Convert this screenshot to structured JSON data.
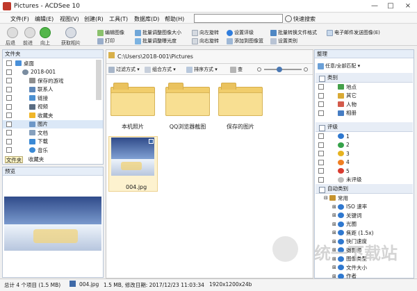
{
  "window": {
    "title": "Pictures - ACDSee 10"
  },
  "menu": [
    "文件(F)",
    "编辑(E)",
    "视图(V)",
    "创建(R)",
    "工具(T)",
    "数据库(D)",
    "帮助(H)"
  ],
  "search": {
    "value": "",
    "quick_search": "快速搜索"
  },
  "toolbar": {
    "back": "后退",
    "forward": "前进",
    "up": "向上",
    "get_photos": "获取相片",
    "actions": [
      "编辑图像",
      "打印",
      "批量调整图像大小",
      "批量调整曝光度",
      "向左旋转",
      "向右旋转",
      "设置评级",
      "添加到图像篮",
      "批量转换文件格式",
      "设置类别",
      "电子邮件发送图像(E)"
    ]
  },
  "folders_panel": {
    "title": "文件夹",
    "tree": [
      "桌面",
      "2018-001",
      "保存的游戏",
      "联系人",
      "链接",
      "视频",
      "收藏夹",
      "图片",
      "文档",
      "下载",
      "音乐"
    ],
    "tabs": [
      "文件夹",
      "收藏夹"
    ]
  },
  "preview_panel": {
    "title": "预览"
  },
  "address": {
    "path": "C:\\Users\\2018-001\\Pictures"
  },
  "view_bar": {
    "filter": "过滤方式",
    "group": "组合方式",
    "sort": "排序方式",
    "view": "查"
  },
  "files": {
    "folders": [
      "本机照片",
      "QQ浏览器截图",
      "保存的图片"
    ],
    "image": "004.jpg"
  },
  "organize_panel": {
    "title": "整理",
    "task": "任意/全部匹配",
    "categories_title": "类别",
    "categories": [
      "地点",
      "其它",
      "人物",
      "相册"
    ],
    "ratings_title": "评级",
    "ratings": [
      "1",
      "2",
      "3",
      "4",
      "5",
      "未评级"
    ],
    "auto_title": "自动类别",
    "auto": [
      "常用",
      "ISO 速率",
      "关键词",
      "光圈",
      "焦距 (1.5x)",
      "快门速度",
      "摄影师",
      "图像类型",
      "文件大小",
      "作者"
    ]
  },
  "status": {
    "total": "总计 4 个项目 (1.5 MB)",
    "file": "004.jpg",
    "meta": "1.5 MB, 修改日期: 2017/12/23 11:03:34",
    "dimensions": "1920x1200x24b"
  },
  "watermark": "统一下载站",
  "colors": {
    "accent": "#3d7fd8",
    "folder": "#f1cd6b",
    "selection": "#fdf2cf"
  }
}
